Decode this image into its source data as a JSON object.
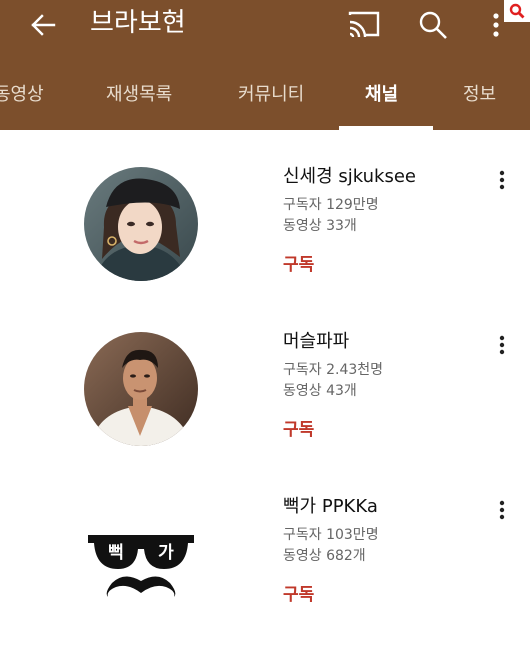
{
  "header": {
    "title": "브라보현",
    "icons": {
      "back": "back-arrow-icon",
      "cast": "cast-icon",
      "search": "search-icon",
      "menu": "more-vert-icon",
      "overlay": "search-icon"
    }
  },
  "tabs": [
    {
      "label": "동영상",
      "active": false
    },
    {
      "label": "재생목록",
      "active": false
    },
    {
      "label": "커뮤니티",
      "active": false
    },
    {
      "label": "채널",
      "active": true
    },
    {
      "label": "정보",
      "active": false
    }
  ],
  "channels": [
    {
      "name": "신세경 sjkuksee",
      "subscribers": "구독자 129만명",
      "videos": "동영상 33개",
      "subscribe_label": "구독",
      "avatar": "woman-in-beret-photo"
    },
    {
      "name": "머슬파파",
      "subscribers": "구독자 2.43천명",
      "videos": "동영상 43개",
      "subscribe_label": "구독",
      "avatar": "man-in-white-shirt-photo"
    },
    {
      "name": "뻑가 PPKKa",
      "subscribers": "구독자 103만명",
      "videos": "동영상 682개",
      "subscribe_label": "구독",
      "avatar": "sunglasses-mustache-logo",
      "logo_text": [
        "뻑",
        "가"
      ]
    }
  ],
  "colors": {
    "appbar": "#7c4f2c",
    "subscribe": "#c0392b",
    "overlay_icon": "#e02020"
  }
}
